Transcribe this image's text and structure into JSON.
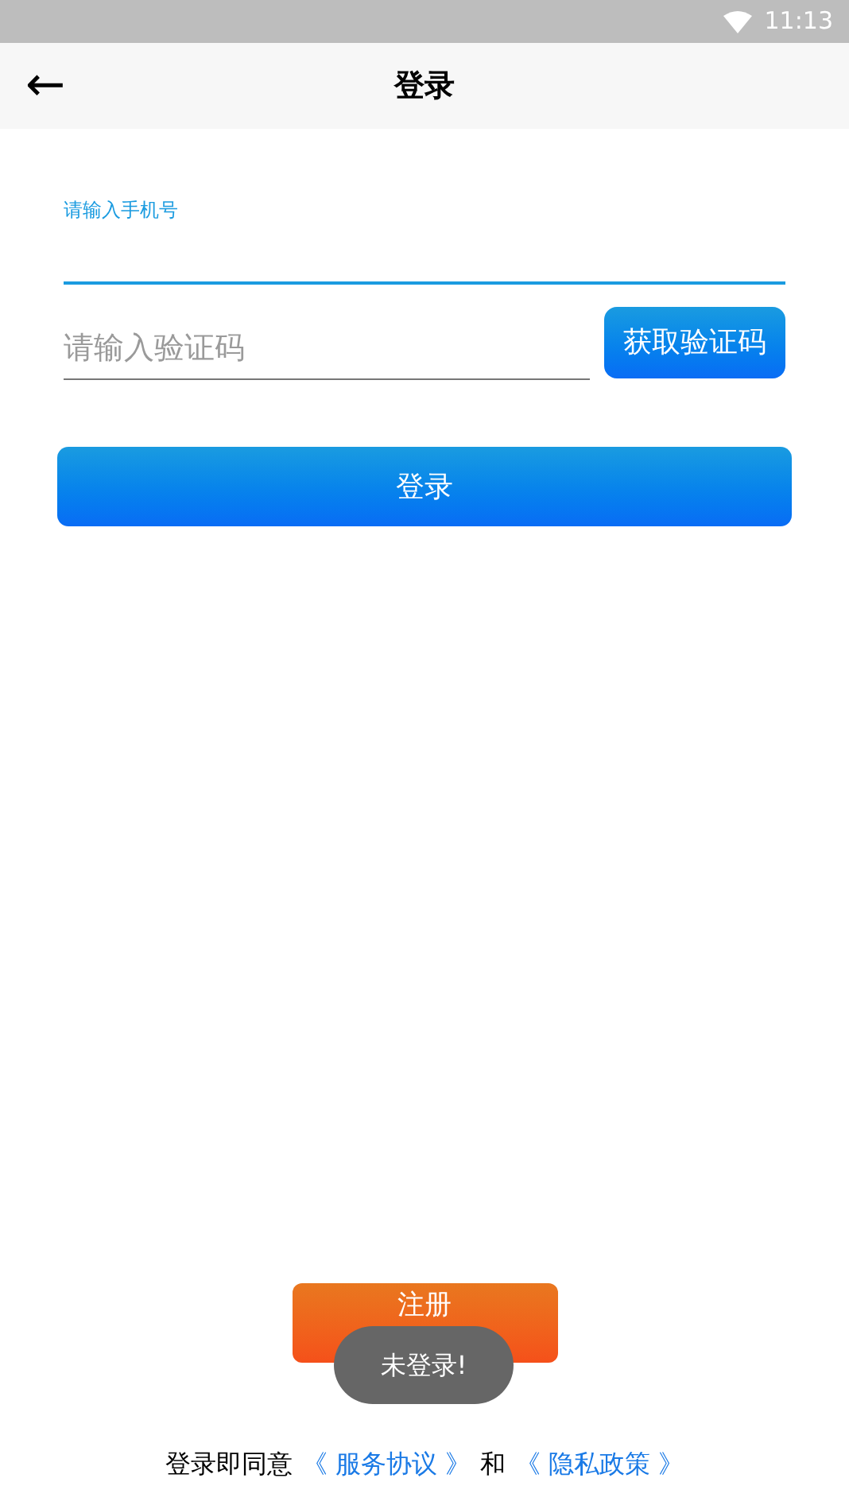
{
  "status_bar": {
    "time": "11:13"
  },
  "header": {
    "back": "←",
    "title": "登录"
  },
  "phone_field": {
    "label": "请输入手机号"
  },
  "code_field": {
    "placeholder": "请输入验证码"
  },
  "get_code_button": "获取验证码",
  "login_button": "登录",
  "register_button": "注册",
  "toast": "未登录!",
  "agreement": {
    "prefix": "登录即同意",
    "service_link": "《 服务协议 》",
    "joiner": "和",
    "privacy_link": "《 隐私政策 》"
  }
}
